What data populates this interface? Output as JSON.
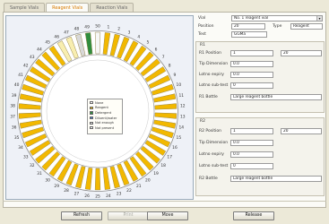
{
  "tabs": [
    "Sample Vials",
    "Reagent Vials",
    "Reaction Vials"
  ],
  "active_tab_index": 1,
  "carousel": {
    "positions": [
      "1",
      "2",
      "3",
      "4",
      "5",
      "6",
      "7",
      "8",
      "9",
      "10",
      "11",
      "12",
      "13",
      "14",
      "15",
      "16",
      "17",
      "18",
      "19",
      "20",
      "21",
      "22",
      "23",
      "24",
      "25",
      "26",
      "27",
      "28",
      "29",
      "30",
      "31",
      "32",
      "33",
      "34",
      "35",
      "36",
      "37",
      "38",
      "39",
      "40",
      "41",
      "42",
      "43",
      "44",
      "45",
      "46",
      "47",
      "48",
      "49",
      "50"
    ],
    "slot_status": [
      "Reagent",
      "Reagent",
      "Reagent",
      "Reagent",
      "Reagent",
      "Reagent",
      "Reagent",
      "Reagent",
      "Reagent",
      "Reagent",
      "Reagent",
      "Reagent",
      "Reagent",
      "Reagent",
      "Reagent",
      "Reagent",
      "Reagent",
      "Reagent",
      "Reagent",
      "Reagent",
      "Reagent",
      "Reagent",
      "Reagent",
      "Reagent",
      "Reagent",
      "Reagent",
      "Reagent",
      "Reagent",
      "Reagent",
      "Reagent",
      "Reagent",
      "Reagent",
      "Reagent",
      "Reagent",
      "Reagent",
      "Reagent",
      "Reagent",
      "Reagent",
      "Reagent",
      "Reagent",
      "Reagent",
      "Reagent",
      "Reagent",
      "Reagent",
      "Reagent",
      "Diluent",
      "Diluent",
      "Not enough",
      "Detergent",
      "Not present"
    ],
    "legend": [
      {
        "label": "None",
        "color": "#ffffff"
      },
      {
        "label": "Reagent",
        "color": "#f2b800"
      },
      {
        "label": "Detergent",
        "color": "#2f8d3d"
      },
      {
        "label": "Diluent/water",
        "color": "#4a7fd0"
      },
      {
        "label": "Not enough",
        "color": "#d8d8d8"
      },
      {
        "label": "Not present",
        "color": "#f7f7f7"
      }
    ],
    "status_colors": {
      "Reagent": "#f2b800",
      "Diluent": "#f8eeb0",
      "Not enough": "#d8d8d8",
      "Detergent": "#2f8d3d",
      "Not present": "#f7f7f7"
    }
  },
  "details": {
    "vial_label": "Vial",
    "vial_value": "No. 1 reagent vial",
    "position_label": "Position",
    "position_value": "20",
    "type_label": "Type",
    "type_value": "Reagent",
    "test_label": "Test",
    "test_value": "GGMa",
    "r1": {
      "title": "R1",
      "position_label": "R1 Position",
      "position_value": "1",
      "position_value2": "20",
      "tip_label": "Tip Dimension",
      "tip_value": "0.0",
      "lotno_label": "Lotno expiry",
      "lotno_value": "0.0",
      "settle_label": "Lotno sub-test",
      "settle_value": "0",
      "bottle_label": "R1 Bottle",
      "bottle_value": "Large reagent bottle"
    },
    "r2": {
      "title": "R2",
      "position_label": "R2 Position",
      "position_value": "1",
      "position_value2": "20",
      "tip_label": "Tip Dimension",
      "tip_value": "0.0",
      "lotno_label": "Lotno expiry",
      "lotno_value": "0.0",
      "settle_label": "Lotno sub-test",
      "settle_value": "0",
      "bottle_label": "R2 Bottle",
      "bottle_value": "Large reagent bottle"
    }
  },
  "buttons": {
    "refresh": "Refresh",
    "print": "Print",
    "move": "Move",
    "release": "Release"
  }
}
